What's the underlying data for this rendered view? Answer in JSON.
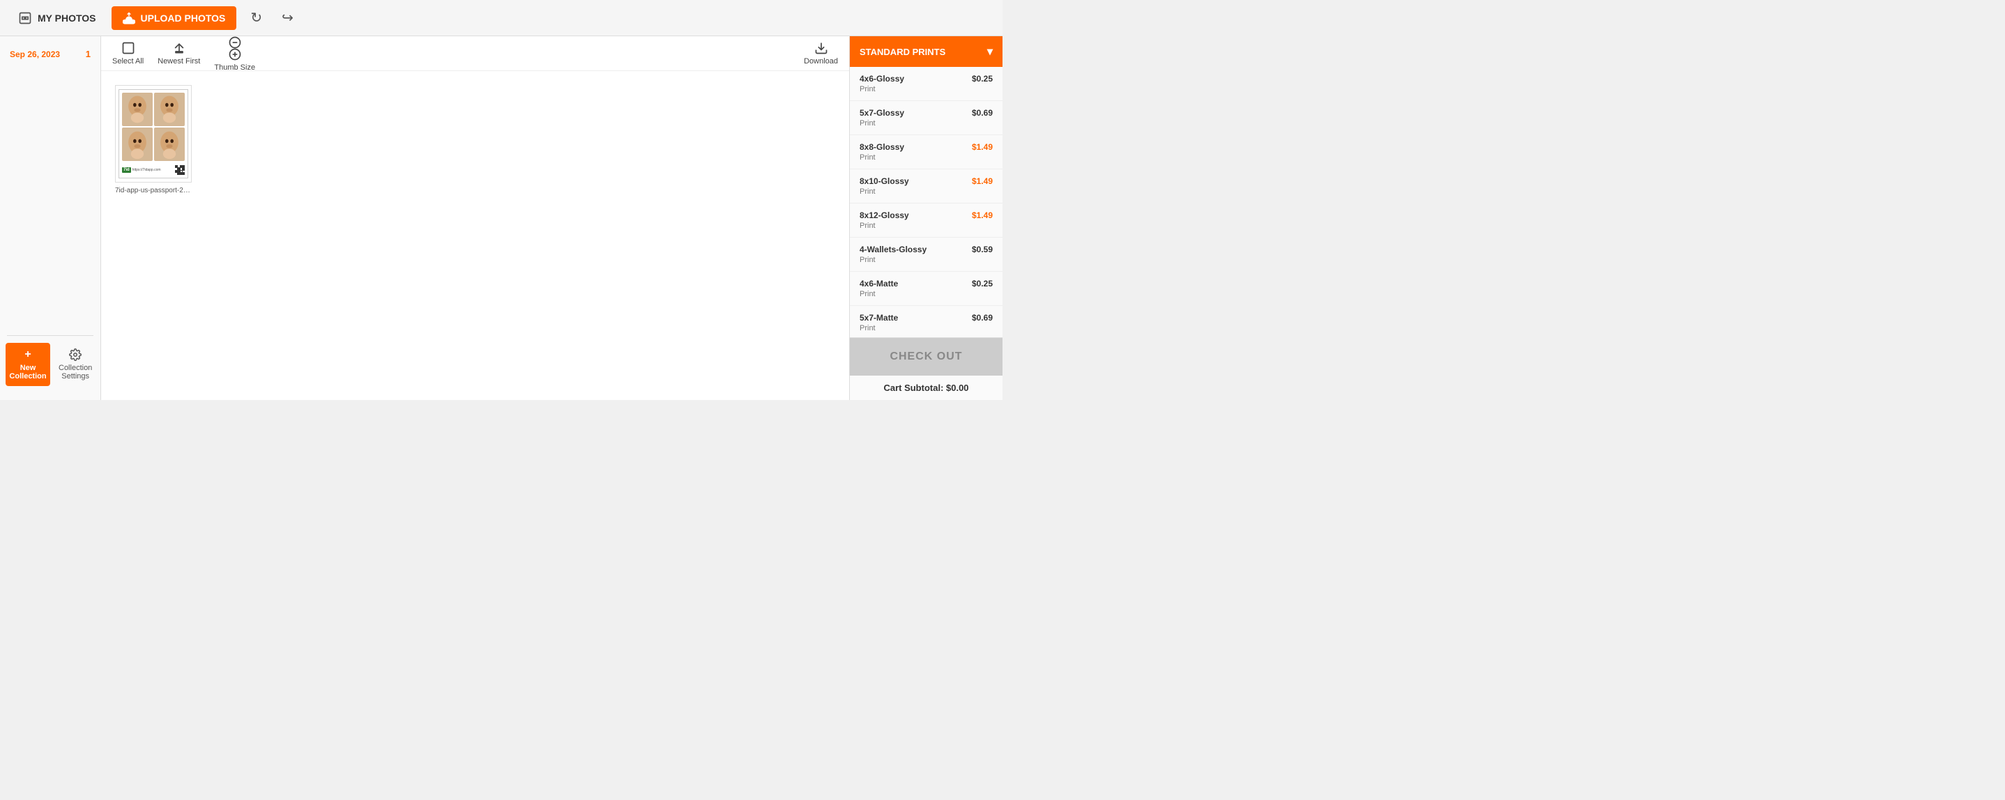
{
  "topbar": {
    "my_photos_label": "MY PHOTOS",
    "upload_label": "UPLOAD PHOTOS",
    "refresh_icon": "↻",
    "share_icon": "↪"
  },
  "sidebar": {
    "date_label": "Sep 26, 2023",
    "date_count": "1",
    "new_collection_label": "New Collection",
    "collection_settings_label": "Collection Settings"
  },
  "toolbar": {
    "select_all_label": "Select All",
    "newest_first_label": "Newest First",
    "thumb_size_label": "Thumb Size",
    "download_label": "Download"
  },
  "photo": {
    "filename": "7id-app-us-passport-2023-09..."
  },
  "right_panel": {
    "standard_prints_label": "STANDARD PRINTS",
    "prints": [
      {
        "name": "4x6-Glossy",
        "type": "Print",
        "price": "$0.25",
        "highlight": false
      },
      {
        "name": "5x7-Glossy",
        "type": "Print",
        "price": "$0.69",
        "highlight": false
      },
      {
        "name": "8x8-Glossy",
        "type": "Print",
        "price": "$1.49",
        "highlight": true
      },
      {
        "name": "8x10-Glossy",
        "type": "Print",
        "price": "$1.49",
        "highlight": true
      },
      {
        "name": "8x12-Glossy",
        "type": "Print",
        "price": "$1.49",
        "highlight": true
      },
      {
        "name": "4-Wallets-Glossy",
        "type": "Print",
        "price": "$0.59",
        "highlight": false
      },
      {
        "name": "4x6-Matte",
        "type": "Print",
        "price": "$0.25",
        "highlight": false
      },
      {
        "name": "5x7-Matte",
        "type": "Print",
        "price": "$0.69",
        "highlight": false
      }
    ],
    "checkout_label": "CHECK OUT",
    "cart_subtotal_label": "Cart Subtotal: $0.00"
  }
}
